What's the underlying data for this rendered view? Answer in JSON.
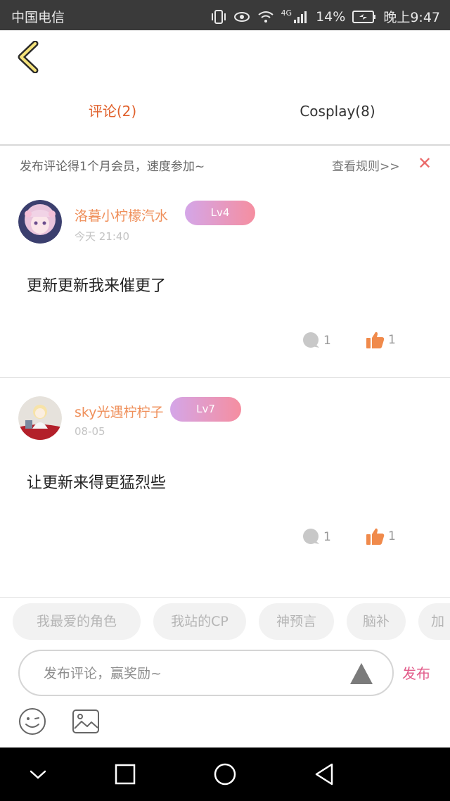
{
  "status_bar": {
    "carrier": "中国电信",
    "network": "4G",
    "battery": "14%",
    "time": "晚上9:47"
  },
  "tabs": [
    {
      "label": "评论(2)",
      "active": true
    },
    {
      "label": "Cosplay(8)",
      "active": false
    }
  ],
  "notice": {
    "text": "发布评论得1个月会员，速度参加~",
    "rules_link": "查看规则>>",
    "close": "✕"
  },
  "comments": [
    {
      "username": "洛暮小柠檬汽水",
      "level": "Lv4",
      "time": "今天 21:40",
      "content": "更新更新我来催更了",
      "reply_count": "1",
      "like_count": "1"
    },
    {
      "username": "sky光遇柠柠子",
      "level": "Lv7",
      "time": "08-05",
      "content": "让更新来得更猛烈些",
      "reply_count": "1",
      "like_count": "1"
    }
  ],
  "tags": [
    "我最爱的角色",
    "我站的CP",
    "神预言",
    "脑补",
    "加"
  ],
  "input": {
    "placeholder": "发布评论，赢奖励~",
    "send_label": "发布"
  },
  "colors": {
    "accent": "#e0612c",
    "username": "#ef8f5a",
    "send": "#e25b8a",
    "like": "#f08a4b"
  },
  "icons": [
    "back-chevron-icon",
    "close-icon",
    "comment-icon",
    "thumbs-up-icon",
    "triangle-icon",
    "emoji-icon",
    "image-icon"
  ]
}
